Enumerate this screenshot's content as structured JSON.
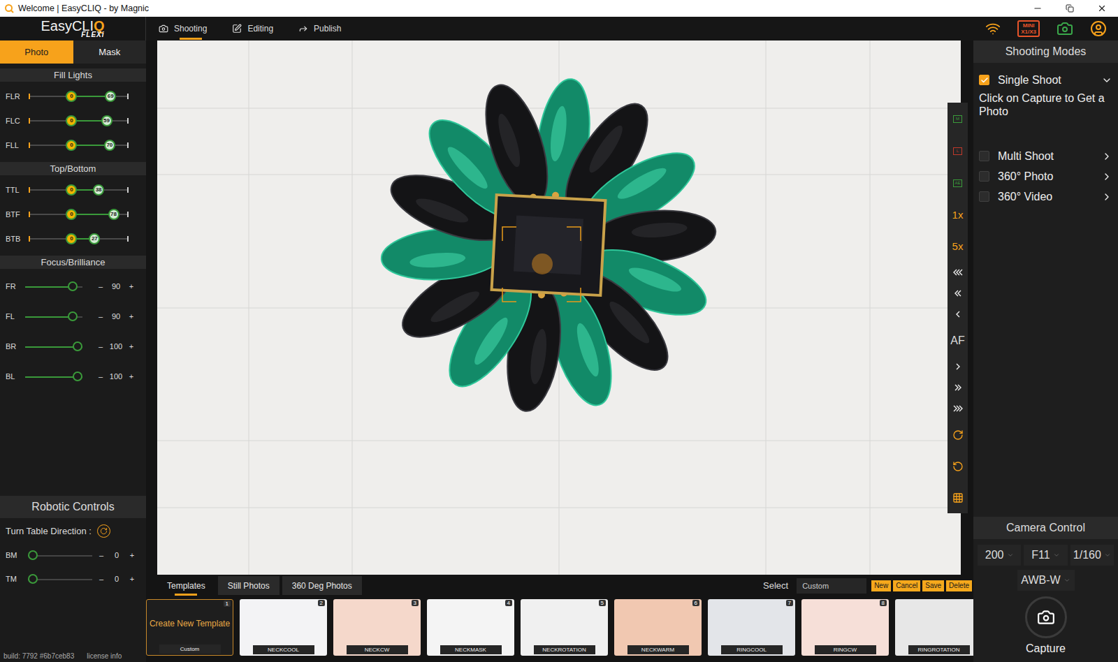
{
  "window": {
    "title": "Welcome | EasyCLIQ - by Magnic"
  },
  "logo": {
    "name": "EasyCLI",
    "accent": "Q",
    "sub": "FLEXi"
  },
  "nav_tabs": [
    {
      "label": "Shooting",
      "selected": true
    },
    {
      "label": "Editing",
      "selected": false
    },
    {
      "label": "Publish",
      "selected": false
    }
  ],
  "device_badge": {
    "top": "MINI",
    "bottom": "X1/X3"
  },
  "left_panel": {
    "tabs": [
      {
        "label": "Photo",
        "selected": true
      },
      {
        "label": "Mask",
        "selected": false
      }
    ],
    "range_sections": [
      {
        "title": "Fill Lights",
        "rows": [
          {
            "label": "FLR",
            "low": "0",
            "high": "69",
            "low_level": 0.43,
            "high_level": 0.82
          },
          {
            "label": "FLC",
            "low": "0",
            "high": "59",
            "low_level": 0.43,
            "high_level": 0.78
          },
          {
            "label": "FLL",
            "low": "0",
            "high": "70",
            "low_level": 0.43,
            "high_level": 0.81
          }
        ]
      },
      {
        "title": "Top/Bottom",
        "rows": [
          {
            "label": "TTL",
            "low": "0",
            "high": "38",
            "low_level": 0.43,
            "high_level": 0.7
          },
          {
            "label": "BTF",
            "low": "0",
            "high": "78",
            "low_level": 0.43,
            "high_level": 0.85
          },
          {
            "label": "BTB",
            "low": "0",
            "high": "27",
            "low_level": 0.43,
            "high_level": 0.66
          }
        ]
      }
    ],
    "focus": {
      "title": "Focus/Brilliance",
      "minus": "–",
      "plus": "+",
      "rows": [
        {
          "label": "FR",
          "value": "90",
          "level": 0.9
        },
        {
          "label": "FL",
          "value": "90",
          "level": 0.9
        },
        {
          "label": "BR",
          "value": "100",
          "level": 1.0
        },
        {
          "label": "BL",
          "value": "100",
          "level": 1.0
        }
      ]
    },
    "robotic": {
      "title": "Robotic Controls",
      "turn_table_label": "Turn Table Direction :",
      "minus": "–",
      "plus": "+",
      "rows": [
        {
          "label": "BM",
          "value": "0",
          "level": 0
        },
        {
          "label": "TM",
          "value": "0",
          "level": 0
        }
      ]
    },
    "footer": {
      "build": "build: 7792 #6b7ceb83",
      "license": "license info"
    }
  },
  "toolbar": [
    {
      "kind": "badge",
      "label": "M",
      "color": "#3a9a3a"
    },
    {
      "kind": "badge",
      "label": "L",
      "color": "#c0392b"
    },
    {
      "kind": "badge",
      "label": "AE",
      "color": "#3a9a3a"
    },
    {
      "kind": "text",
      "label": "1x"
    },
    {
      "kind": "text",
      "label": "5x"
    },
    {
      "kind": "chevron"
    },
    {
      "kind": "chevron"
    },
    {
      "kind": "chevron"
    },
    {
      "kind": "text",
      "label": "AF"
    },
    {
      "kind": "chevron"
    },
    {
      "kind": "chevron"
    },
    {
      "kind": "chevron"
    },
    {
      "kind": "action"
    },
    {
      "kind": "action"
    },
    {
      "kind": "action"
    }
  ],
  "shooting_modes": {
    "title": "Shooting Modes",
    "modes": [
      {
        "label": "Single Shoot",
        "checked": true,
        "expanded": true,
        "description": "Click on Capture to Get a Photo"
      },
      {
        "label": "Multi Shoot",
        "checked": false,
        "expanded": false
      },
      {
        "label": "360° Photo",
        "checked": false,
        "expanded": false
      },
      {
        "label": "360° Video",
        "checked": false,
        "expanded": false
      }
    ]
  },
  "camera_control": {
    "title": "Camera Control",
    "settings": [
      "200",
      "F11",
      "1/160"
    ],
    "white_balance": "AWB-W",
    "capture_label": "Capture"
  },
  "bottom": {
    "tabs": [
      {
        "label": "Templates",
        "selected": true
      },
      {
        "label": "Still Photos",
        "selected": false
      },
      {
        "label": "360 Deg Photos",
        "selected": false
      }
    ],
    "select_label": "Select",
    "select_value": "Custom",
    "buttons": [
      "New",
      "Cancel",
      "Save",
      "Delete"
    ],
    "templates": [
      {
        "kind": "create",
        "label": "Create New Template",
        "caption": "Custom",
        "number": "1",
        "selected": true
      },
      {
        "kind": "photo",
        "caption": "NECKCOOL",
        "number": "2",
        "selected": false,
        "color": "#f3f3f5"
      },
      {
        "kind": "photo",
        "caption": "NECKCW",
        "number": "3",
        "selected": false,
        "color": "#f5d8cb"
      },
      {
        "kind": "photo",
        "caption": "NECKMASK",
        "number": "4",
        "selected": false,
        "color": "#f4f4f4"
      },
      {
        "kind": "photo",
        "caption": "NECKROTATION",
        "number": "5",
        "selected": false,
        "color": "#f0f0f0"
      },
      {
        "kind": "photo",
        "caption": "NECKWARM",
        "number": "6",
        "selected": false,
        "color": "#f1c8b1"
      },
      {
        "kind": "photo",
        "caption": "RINGCOOL",
        "number": "7",
        "selected": false,
        "color": "#e3e5e9"
      },
      {
        "kind": "photo",
        "caption": "RINGCW",
        "number": "8",
        "selected": false,
        "color": "#f6dfd8"
      },
      {
        "kind": "photo",
        "caption": "RINGROTATION",
        "selected": false,
        "color": "#e7e7e7"
      }
    ]
  }
}
